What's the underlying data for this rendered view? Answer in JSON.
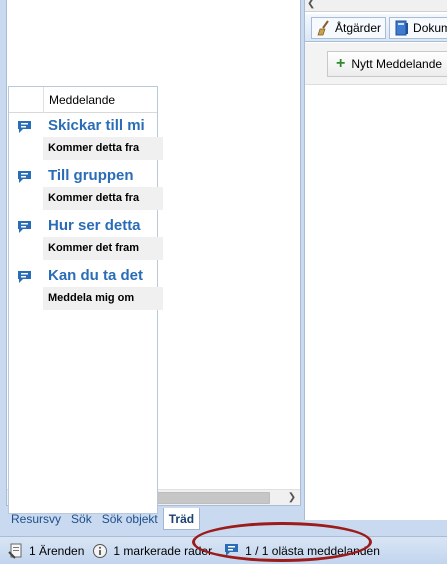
{
  "left_nav": {
    "tabs": [
      {
        "label": "Resursvy"
      },
      {
        "label": "Sök"
      },
      {
        "label": "Sök objekt"
      },
      {
        "label": "Träd",
        "active": true
      }
    ]
  },
  "toolbar": {
    "tabs": [
      {
        "label": "Åtgärder",
        "icon": "broom-icon"
      },
      {
        "label": "Dokum",
        "icon": "document-icon"
      }
    ],
    "new_message_label": "Nytt Meddelande"
  },
  "messages_grid": {
    "column_header": "Meddelande",
    "rows": [
      {
        "title": "Skickar till mi",
        "preview": "Kommer detta fra",
        "icon": "chat-bubble-icon"
      },
      {
        "title": "Till gruppen",
        "preview": "Kommer detta fra",
        "icon": "chat-bubble-icon"
      },
      {
        "title": "Hur ser detta",
        "preview": "Kommer det fram",
        "icon": "chat-bubble-icon"
      },
      {
        "title": "Kan du ta det",
        "preview": "Meddela mig om",
        "icon": "chat-bubble-icon"
      }
    ]
  },
  "status_bar": {
    "cases": "1 Ärenden",
    "selected_rows": "1 markerade rader",
    "unread_messages": "1 / 1 olästa meddelanden"
  },
  "colors": {
    "accent": "#2a6db7",
    "background": "#c9daf0",
    "highlight_oval": "#9c1b1b"
  }
}
